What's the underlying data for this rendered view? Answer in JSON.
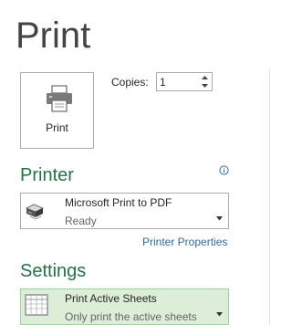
{
  "page": {
    "title": "Print"
  },
  "print_button": {
    "label": "Print",
    "icon": "printer-icon"
  },
  "copies": {
    "label": "Copies:",
    "value": "1"
  },
  "printer_section": {
    "heading": "Printer",
    "info_icon": "info-icon",
    "selected": {
      "name": "Microsoft Print to PDF",
      "status": "Ready",
      "icon": "printer-device-icon"
    },
    "properties_link": "Printer Properties"
  },
  "settings_section": {
    "heading": "Settings",
    "selected": {
      "title": "Print Active Sheets",
      "description": "Only print the active sheets",
      "icon": "sheets-grid-icon"
    }
  },
  "colors": {
    "accent": "#217346",
    "link": "#2e6ca4",
    "selected_bg": "#dcedd8"
  }
}
